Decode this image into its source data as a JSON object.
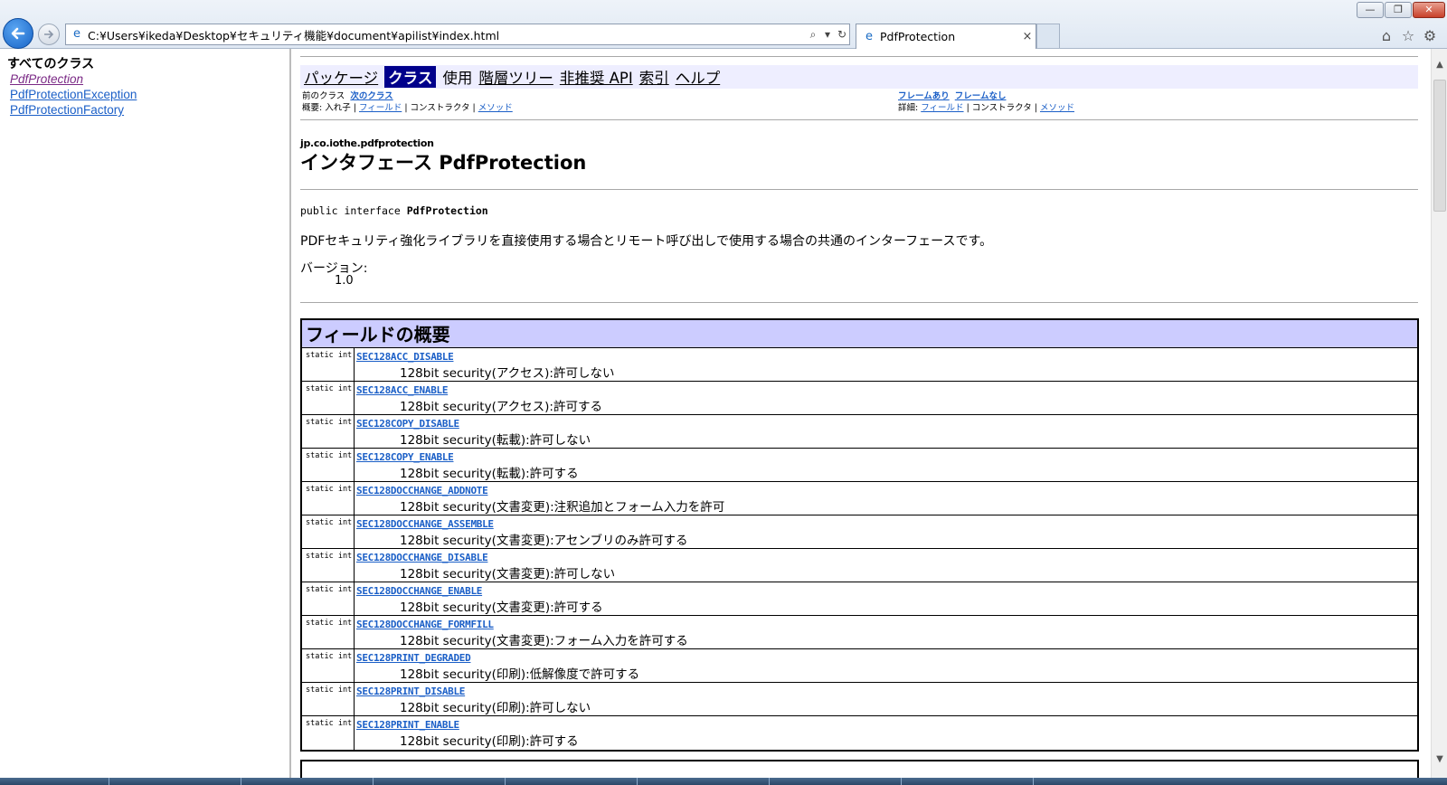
{
  "browser": {
    "address": "C:¥Users¥ikeda¥Desktop¥セキュリティ機能¥document¥apilist¥index.html",
    "tab_title": "PdfProtection",
    "window_controls": [
      "minimize",
      "maximize",
      "close"
    ],
    "toolbar_icons": [
      "home-icon",
      "star-icon",
      "gear-icon"
    ]
  },
  "left_frame": {
    "heading": "すべてのクラス",
    "classes": [
      "PdfProtection",
      "PdfProtectionException",
      "PdfProtectionFactory"
    ]
  },
  "navbar": {
    "items": [
      "パッケージ",
      "クラス",
      "使用",
      "階層ツリー",
      "非推奨 API",
      "索引",
      "ヘルプ"
    ],
    "current": "クラス"
  },
  "subnav": {
    "prev_class": "前のクラス",
    "next_class": "次のクラス",
    "frames": "フレームあり",
    "no_frames": "フレームなし",
    "summary_label": "概要: 入れ子 |",
    "summary_field": "フィールド",
    "summary_sep1": "| コンストラクタ |",
    "summary_method": "メソッド",
    "detail_label": "詳細:",
    "detail_field": "フィールド",
    "detail_sep1": "| コンストラクタ |",
    "detail_method": "メソッド"
  },
  "class_info": {
    "package": "jp.co.iothe.pdfprotection",
    "title": "インタフェース PdfProtection",
    "signature_prefix": "public interface ",
    "signature_name": "PdfProtection",
    "description": "PDFセキュリティ強化ライブラリを直接使用する場合とリモート呼び出しで使用する場合の共通のインターフェースです。",
    "version_label": "バージョン:",
    "version": "1.0"
  },
  "field_summary": {
    "title": "フィールドの概要",
    "rows": [
      {
        "type": "static int",
        "name": "SEC128ACC_DISABLE",
        "desc": "128bit security(アクセス):許可しない"
      },
      {
        "type": "static int",
        "name": "SEC128ACC_ENABLE",
        "desc": "128bit security(アクセス):許可する"
      },
      {
        "type": "static int",
        "name": "SEC128COPY_DISABLE",
        "desc": "128bit security(転載):許可しない"
      },
      {
        "type": "static int",
        "name": "SEC128COPY_ENABLE",
        "desc": "128bit security(転載):許可する"
      },
      {
        "type": "static int",
        "name": "SEC128DOCCHANGE_ADDNOTE",
        "desc": "128bit security(文書変更):注釈追加とフォーム入力を許可"
      },
      {
        "type": "static int",
        "name": "SEC128DOCCHANGE_ASSEMBLE",
        "desc": "128bit security(文書変更):アセンブリのみ許可する"
      },
      {
        "type": "static int",
        "name": "SEC128DOCCHANGE_DISABLE",
        "desc": "128bit security(文書変更):許可しない"
      },
      {
        "type": "static int",
        "name": "SEC128DOCCHANGE_ENABLE",
        "desc": "128bit security(文書変更):許可する"
      },
      {
        "type": "static int",
        "name": "SEC128DOCCHANGE_FORMFILL",
        "desc": "128bit security(文書変更):フォーム入力を許可する"
      },
      {
        "type": "static int",
        "name": "SEC128PRINT_DEGRADED",
        "desc": "128bit security(印刷):低解像度で許可する"
      },
      {
        "type": "static int",
        "name": "SEC128PRINT_DISABLE",
        "desc": "128bit security(印刷):許可しない"
      },
      {
        "type": "static int",
        "name": "SEC128PRINT_ENABLE",
        "desc": "128bit security(印刷):許可する"
      }
    ]
  }
}
